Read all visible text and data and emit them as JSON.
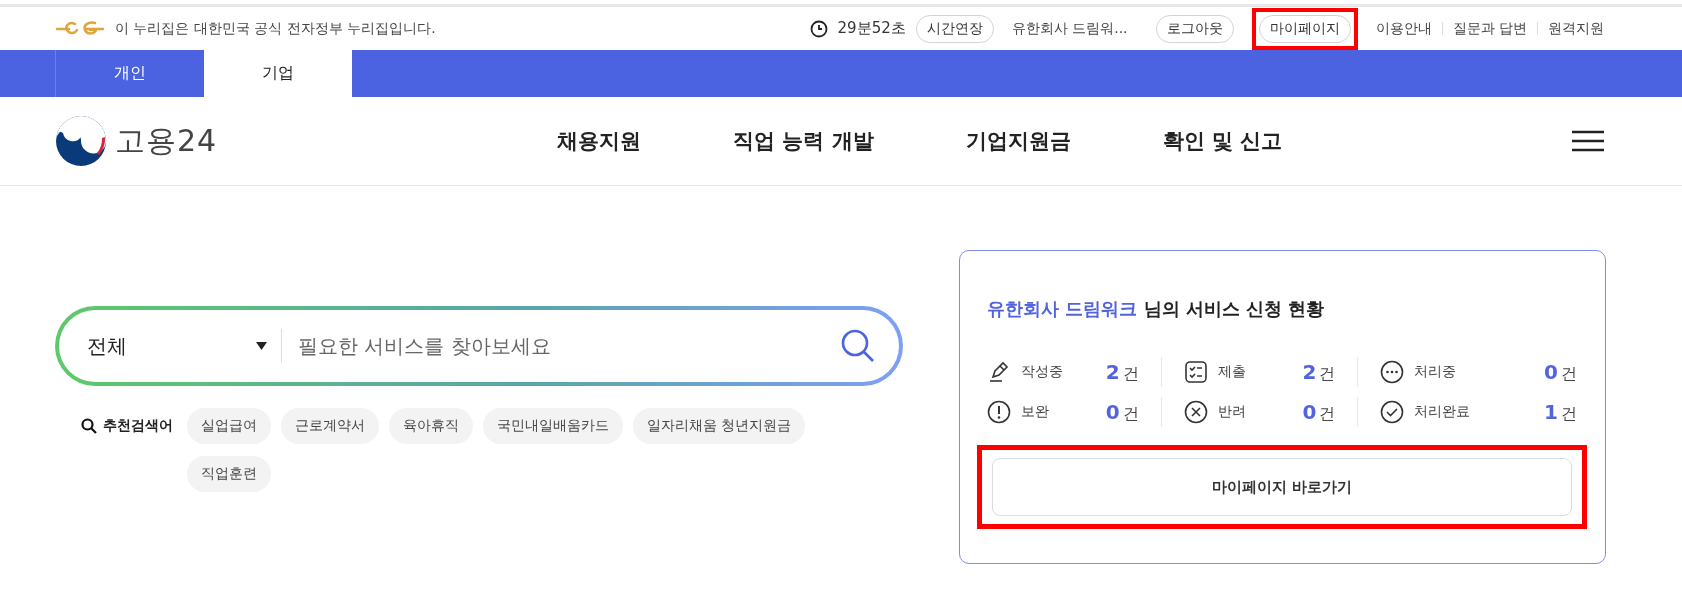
{
  "top_bar": {
    "notice": "이 누리집은 대한민국 공식 전자정부 누리집입니다.",
    "timer": "29분52초",
    "extend_button": "시간연장",
    "user_name": "유한회사 드림워...",
    "logout_button": "로그아웃",
    "mypage_button": {
      "label": "마이페이지",
      "highlighted": true
    },
    "links": [
      "이용안내",
      "질문과 답변",
      "원격지원"
    ]
  },
  "tabs": [
    {
      "label": "개인",
      "selected": false
    },
    {
      "label": "기업",
      "selected": true
    }
  ],
  "header": {
    "logo_text": "고용24",
    "nav": [
      "채용지원",
      "직업 능력 개발",
      "기업지원금",
      "확인 및 신고"
    ]
  },
  "search": {
    "category": "전체",
    "placeholder": "필요한 서비스를 찾아보세요",
    "recommend_label": "추천검색어",
    "keywords": [
      "실업급여",
      "근로계약서",
      "육아휴직",
      "국민내일배움카드",
      "일자리채움 청년지원금",
      "직업훈련"
    ]
  },
  "status_card": {
    "user_name": "유한회사 드림워크",
    "title_suffix": " 님의 서비스 신청 현황",
    "items": [
      {
        "kind": "pencil",
        "label": "작성중",
        "count": "2",
        "unit": "건"
      },
      {
        "kind": "checklist",
        "label": "제출",
        "count": "2",
        "unit": "건"
      },
      {
        "kind": "dots",
        "label": "처리중",
        "count": "0",
        "unit": "건"
      },
      {
        "kind": "exclaim",
        "label": "보완",
        "count": "0",
        "unit": "건"
      },
      {
        "kind": "cross",
        "label": "반려",
        "count": "0",
        "unit": "건"
      },
      {
        "kind": "check",
        "label": "처리완료",
        "count": "1",
        "unit": "건"
      }
    ],
    "button": {
      "label": "마이페이지 바로가기",
      "highlighted": true
    }
  }
}
